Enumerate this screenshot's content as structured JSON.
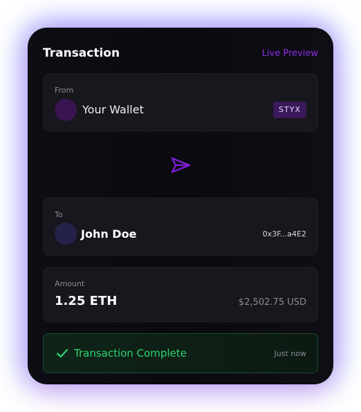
{
  "header": {
    "title": "Transaction",
    "preview_label": "Live Preview"
  },
  "from": {
    "label": "From",
    "name": "Your Wallet",
    "badge": "STYX"
  },
  "send_icon": "paper-plane-icon",
  "to": {
    "label": "To",
    "name": "John Doe",
    "address": "0x3F...a4E2"
  },
  "amount": {
    "label": "Amount",
    "value": "1.25 ETH",
    "usd": "$2,502.75 USD"
  },
  "status": {
    "icon": "check-icon",
    "text": "Transaction Complete",
    "time": "Just now"
  },
  "colors": {
    "accent": "#8a2be2",
    "success": "#2ed573",
    "card_bg": "#0d0d14"
  }
}
